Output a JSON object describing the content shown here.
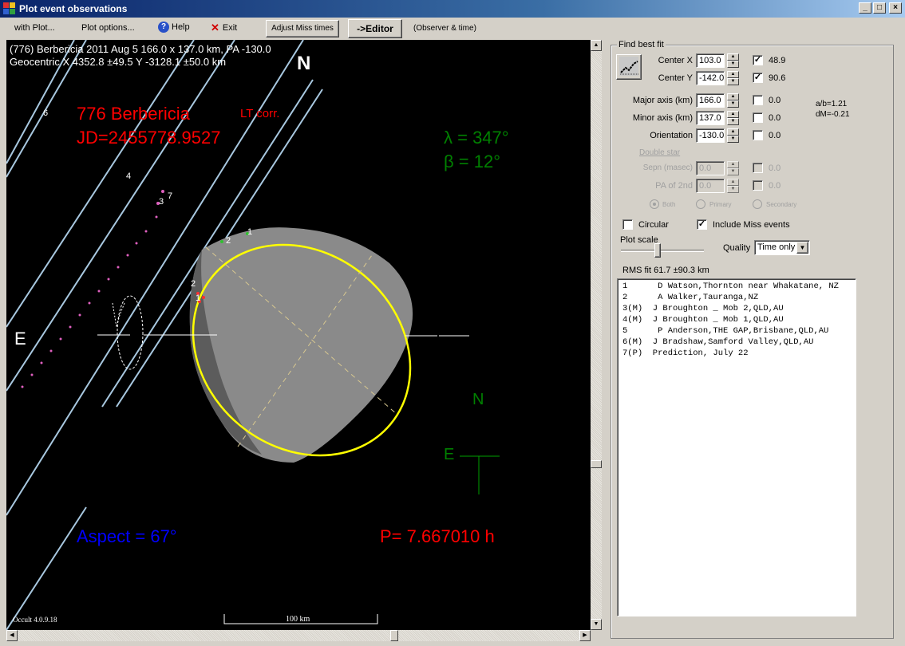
{
  "window": {
    "title": "Plot event observations",
    "controls": [
      "_",
      "□",
      "×"
    ]
  },
  "menu": {
    "with_plot": "with Plot...",
    "plot_options": "Plot options...",
    "help": "Help",
    "exit": "Exit",
    "adjust_miss": "Adjust Miss times",
    "editor": "->Editor",
    "observer_time": "(Observer & time)"
  },
  "plot": {
    "header_line1": "(776) Berbericia  2011 Aug 5   166.0 x 137.0 km, PA -130.0",
    "header_line2": "Geocentric X  4352.8 ±49.5  Y -3128.1 ±50.0 km",
    "north_label": "N",
    "east_label": "E",
    "asteroid_name": "776 Berbericia",
    "lt_corr": "LT corr.",
    "jd": "JD=2455778.9527",
    "lambda": "λ =  347°",
    "beta": "β =   12°",
    "compass_n": "N",
    "compass_e": "E",
    "aspect": "Aspect = 67°",
    "period": "P= 7.667010 h",
    "version": "Occult 4.0.9.18",
    "scale_bar": "100 km",
    "chord_labels": [
      "1",
      "2",
      "2",
      "1",
      "3",
      "4",
      "6",
      "7"
    ],
    "colors": {
      "red_text": "#ff0000",
      "green_text": "#008000",
      "blue_text": "#0000ff",
      "ellipse": "#ffff00",
      "chord": "#a8c8e0",
      "shape": "#808080"
    }
  },
  "fit": {
    "group_title": "Find best fit",
    "rows": [
      {
        "label": "Center X",
        "value": "103.0",
        "checked": true,
        "result": "48.9"
      },
      {
        "label": "Center Y",
        "value": "-142.0",
        "checked": true,
        "result": "90.6"
      },
      {
        "label": "Major axis (km)",
        "value": "166.0",
        "checked": false,
        "result": "0.0"
      },
      {
        "label": "Minor axis (km)",
        "value": "137.0",
        "checked": false,
        "result": "0.0"
      },
      {
        "label": "Orientation",
        "value": "-130.0",
        "checked": false,
        "result": "0.0"
      }
    ],
    "ab_ratio": "a/b=1.21",
    "dm": "dM=-0.21",
    "double_star": {
      "title": "Double star",
      "sepn_label": "Sepn (masec)",
      "sepn_value": "0.0",
      "sepn_result": "0.0",
      "pa_label": "PA of 2nd",
      "pa_value": "0.0",
      "pa_result": "0.0",
      "radio_both": "Both",
      "radio_primary": "Primary",
      "radio_secondary": "Secondary"
    },
    "circular_label": "Circular",
    "circular_checked": false,
    "include_miss_label": "Include Miss events",
    "include_miss_checked": true,
    "plot_scale_label": "Plot scale",
    "plot_scale_value": 0.45,
    "quality_label": "Quality",
    "quality_value": "Time only",
    "rms": "RMS fit 61.7 ±90.3 km"
  },
  "observers": [
    "1      D Watson,Thornton near Whakatane, NZ",
    "2      A Walker,Tauranga,NZ",
    "3(M)  J Broughton _ Mob 2,QLD,AU",
    "4(M)  J Broughton _ Mob 1,QLD,AU",
    "5      P Anderson,THE GAP,Brisbane,QLD,AU",
    "6(M)  J Bradshaw,Samford Valley,QLD,AU",
    "7(P)  Prediction, July 22"
  ]
}
